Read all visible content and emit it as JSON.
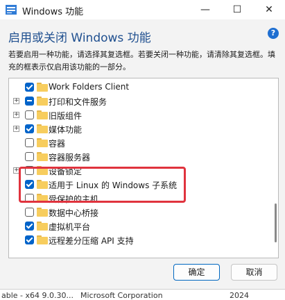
{
  "window": {
    "title": "Windows 功能",
    "minimize_glyph": "—",
    "maximize_glyph": "☐",
    "close_glyph": "✕"
  },
  "heading": "启用或关闭 Windows 功能",
  "help_glyph": "?",
  "description": "若要启用一种功能，请选择其复选框。若要关闭一种功能，请清除其复选框。填充的框表示仅启用该功能的一部分。",
  "features": [
    {
      "label": "Work Folders Client",
      "state": "checked",
      "expandable": false
    },
    {
      "label": "打印和文件服务",
      "state": "partial",
      "expandable": true
    },
    {
      "label": "旧版组件",
      "state": "unchecked",
      "expandable": true
    },
    {
      "label": "媒体功能",
      "state": "checked",
      "expandable": true
    },
    {
      "label": "容器",
      "state": "unchecked",
      "expandable": false
    },
    {
      "label": "容器服务器",
      "state": "unchecked",
      "expandable": false
    },
    {
      "label": "设备锁定",
      "state": "unchecked",
      "expandable": true
    },
    {
      "label": "适用于 Linux 的 Windows 子系统",
      "state": "checked",
      "expandable": false
    },
    {
      "label": "受保护的主机",
      "state": "unchecked",
      "expandable": false
    },
    {
      "label": "数据中心桥接",
      "state": "unchecked",
      "expandable": false
    },
    {
      "label": "虚拟机平台",
      "state": "checked",
      "expandable": false
    },
    {
      "label": "远程差分压缩 API 支持",
      "state": "checked",
      "expandable": false
    }
  ],
  "buttons": {
    "ok": "确定",
    "cancel": "取消"
  },
  "background_strip": {
    "col1": "able - x64 9.0.30...",
    "col2": "Microsoft Corporation",
    "col3": "2024"
  },
  "colors": {
    "accent": "#0063c9",
    "heading": "#1f4f8f",
    "highlight": "#e0333e",
    "folder": "#f7cd5e"
  }
}
